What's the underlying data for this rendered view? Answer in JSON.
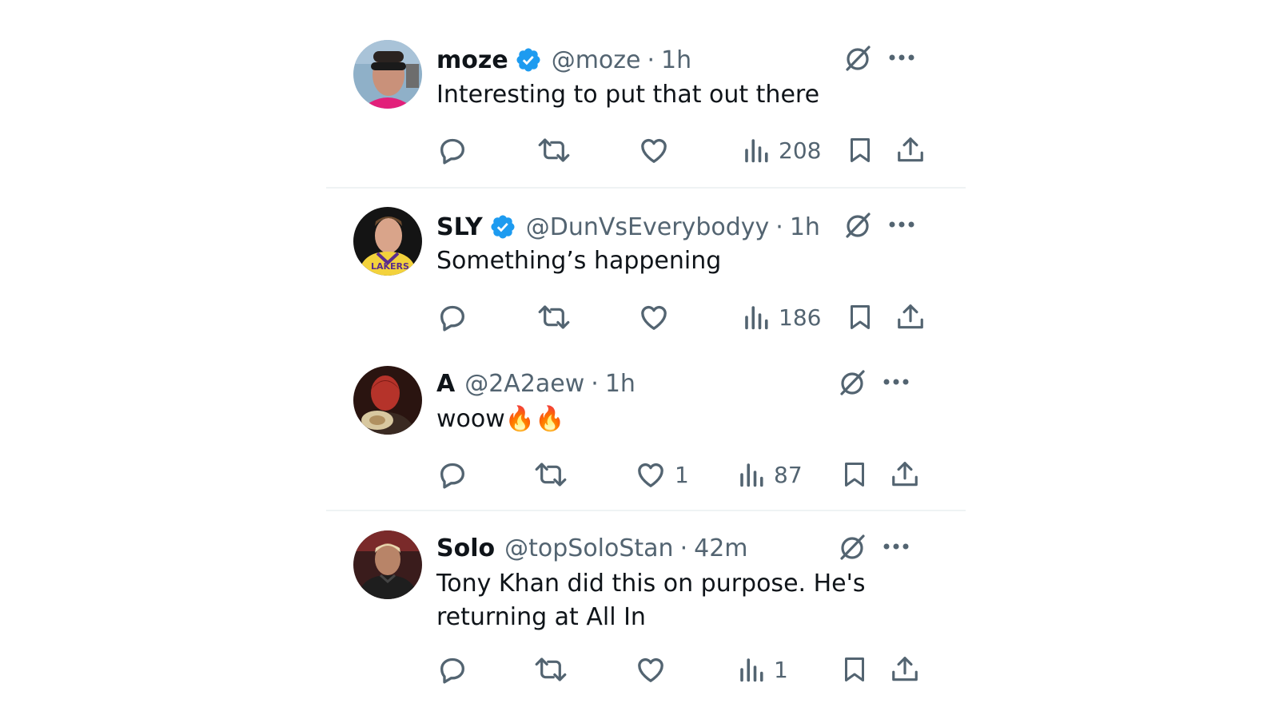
{
  "tweets": [
    {
      "name": "moze",
      "verified": true,
      "handle": "@moze",
      "separator": "·",
      "time": "1h",
      "text": "Interesting to put that out there",
      "replies": "",
      "retweets": "",
      "likes": "",
      "views": "208"
    },
    {
      "name": "SLY",
      "verified": true,
      "handle": "@DunVsEverybodyy",
      "separator": "·",
      "time": "1h",
      "text": "Something’s happening",
      "replies": "",
      "retweets": "",
      "likes": "",
      "views": "186"
    },
    {
      "name": "A",
      "verified": false,
      "handle": "@2A2aew",
      "separator": "·",
      "time": "1h",
      "text": "woow🔥🔥",
      "replies": "",
      "retweets": "",
      "likes": "1",
      "views": "87"
    },
    {
      "name": "Solo",
      "verified": false,
      "handle": "@topSoloStan",
      "separator": "·",
      "time": "42m",
      "text": "Tony Khan did this on purpose. He's returning at All In",
      "replies": "",
      "retweets": "",
      "likes": "",
      "views": "1"
    }
  ],
  "icons": {
    "verified": "verified-badge-icon",
    "grok": "grok-icon",
    "more": "more-icon",
    "reply": "reply-icon",
    "retweet": "retweet-icon",
    "like": "like-icon",
    "views": "views-icon",
    "bookmark": "bookmark-icon",
    "share": "share-icon"
  },
  "colors": {
    "text_primary": "#0f1419",
    "text_secondary": "#536471",
    "verified_blue": "#1d9bf0",
    "divider": "#eff3f4"
  }
}
